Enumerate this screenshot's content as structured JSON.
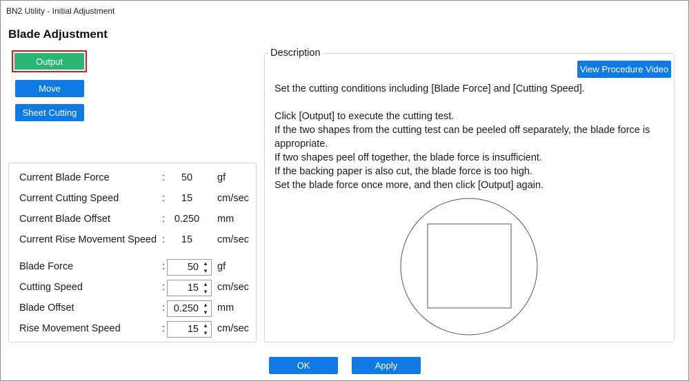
{
  "window": {
    "title": "BN2 Utility - Initial Adjustment"
  },
  "page": {
    "title": "Blade Adjustment"
  },
  "actions": {
    "output_label": "Output",
    "move_label": "Move",
    "sheet_cutting_label": "Sheet Cutting"
  },
  "current": {
    "blade_force": {
      "label": "Current Blade Force",
      "colon": ":",
      "value": "50",
      "unit": "gf"
    },
    "cutting_speed": {
      "label": "Current Cutting Speed",
      "colon": ":",
      "value": "15",
      "unit": "cm/sec"
    },
    "blade_offset": {
      "label": "Current Blade Offset",
      "colon": ":",
      "value": "0.250",
      "unit": "mm"
    },
    "rise_speed": {
      "label": "Current Rise Movement Speed",
      "colon": ":",
      "value": "15",
      "unit": "cm/sec"
    }
  },
  "settings": {
    "blade_force": {
      "label": "Blade Force",
      "colon": ":",
      "value": "50",
      "unit": "gf"
    },
    "cutting_speed": {
      "label": "Cutting Speed",
      "colon": ":",
      "value": "15",
      "unit": "cm/sec"
    },
    "blade_offset": {
      "label": "Blade Offset",
      "colon": ":",
      "value": "0.250",
      "unit": "mm"
    },
    "rise_speed": {
      "label": "Rise Movement Speed",
      "colon": ":",
      "value": "15",
      "unit": "cm/sec"
    }
  },
  "description": {
    "legend": "Description",
    "video_label": "View Procedure Video",
    "line1": "Set the cutting conditions including [Blade Force] and [Cutting Speed].",
    "line2": "Click [Output] to execute the cutting test.",
    "line3": "If the two shapes from the cutting test can be peeled off separately, the blade force is appropriate.",
    "line4": "If two shapes peel off together, the blade force is insufficient.",
    "line5": "If the backing paper is also cut, the blade force is too high.",
    "line6": "Set the blade force once more, and then click [Output] again."
  },
  "footer": {
    "ok_label": "OK",
    "apply_label": "Apply"
  },
  "colors": {
    "accent_blue": "#0f79e4",
    "output_green": "#2bb673",
    "highlight_red": "#e0161e"
  }
}
